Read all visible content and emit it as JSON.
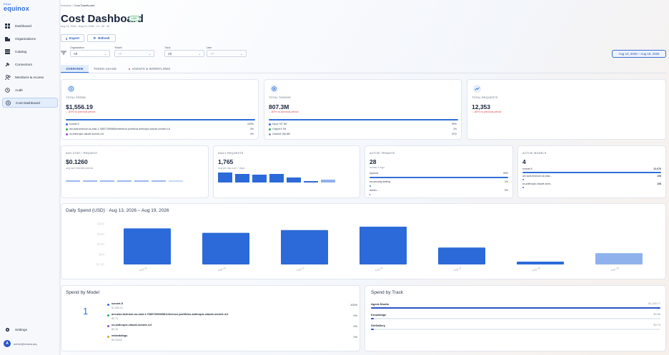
{
  "brand": {
    "line1": "Eltaz",
    "line2": "equinox"
  },
  "sidebar": {
    "items": [
      {
        "label": "Dashboard",
        "icon": "grid-icon"
      },
      {
        "label": "Organizations",
        "icon": "building-icon"
      },
      {
        "label": "Catalog",
        "icon": "catalog-icon"
      },
      {
        "label": "Connectors",
        "icon": "plug-icon"
      },
      {
        "label": "Members & Access",
        "icon": "users-icon"
      },
      {
        "label": "Audit",
        "icon": "history-icon"
      },
      {
        "label": "Cost Dashboard",
        "icon": "dollar-icon"
      }
    ],
    "settings": "Settings",
    "user": {
      "initial": "A",
      "email": "admin@retava.aiq"
    }
  },
  "breadcrumb": {
    "root": "Instance",
    "sep": "/",
    "current": "Cost Dashboard"
  },
  "page": {
    "title": "Cost Dashboard",
    "badge": "LIVE",
    "subtitle": "Aug 13, 2026 – Aug 19, 2026 · 14 · 49 · 44"
  },
  "actions": {
    "export": "Export",
    "refresh": "Refresh"
  },
  "filters": {
    "organization": {
      "label": "Organization",
      "value": "All"
    },
    "tenant": {
      "label": "Tenant",
      "value": "All"
    },
    "track": {
      "label": "Track",
      "value": "All"
    },
    "user": {
      "label": "User",
      "value": "All"
    }
  },
  "date_button": "Aug 13, 2026 – Aug 19, 2026",
  "tabs": [
    "OVERVIEW",
    "TOKEN USAGE",
    "AGENTS & WORKFLOWS"
  ],
  "kpi": {
    "spend": {
      "label": "TOTAL SPEND",
      "value": "$1,556.19",
      "delta": "↓ -53% vs previous period",
      "rows": [
        {
          "name": "sonnet-5",
          "pct": "100%",
          "color": "#2f6fd8"
        },
        {
          "name": "arn:aws:bedrock:us-east-1:768072969658:inference-profile/us.anthropic.claude-sonnet-4-6",
          "pct": "0%",
          "color": "#2fa66a"
        },
        {
          "name": "us.anthropic.claude-sonnet-4-6",
          "pct": "0%",
          "color": "#8a4fd8"
        }
      ]
    },
    "tokens": {
      "label": "TOTAL TOKENS",
      "value": "807.3M",
      "delta": "↓ -82% vs previous period",
      "rows": [
        {
          "name": "Input 797.3M",
          "pct": "99%",
          "color": "#2f6fd8"
        },
        {
          "name": "Output 5.7M",
          "pct": "1%",
          "color": "#2fa66a"
        },
        {
          "name": "Cached 166.8M",
          "pct": "21%",
          "color": "#8a93a3"
        }
      ]
    },
    "requests": {
      "label": "TOTAL REQUESTS",
      "value": "12,353",
      "delta": "↓ -80% vs previous period"
    }
  },
  "cards2": {
    "avg": {
      "label": "AVG COST / REQUEST",
      "value": "$0.1260",
      "sub": "avg over selected period"
    },
    "daily": {
      "label": "DAILY REQUESTS",
      "value": "1,765",
      "sub": "avg per day over 7 days"
    },
    "tenants": {
      "label": "ACTIVE TENANTS",
      "value": "28",
      "sub": "across 4 orgs",
      "rows": [
        {
          "name": "equinox",
          "pct": "99%"
        },
        {
          "name": "ics-security-testing",
          "pct": "1%"
        },
        {
          "name": "admin-...",
          "pct": "0%"
        }
      ]
    },
    "models": {
      "label": "ACTIVE MODELS",
      "value": "4",
      "rows": [
        {
          "name": "sonnet-5",
          "val": "12,075"
        },
        {
          "name": "arn:aws:bedrock:us-east-...",
          "val": "108"
        },
        {
          "name": "us.anthropic.claude-sonn...",
          "val": "108"
        }
      ]
    }
  },
  "daily_spend": {
    "title": "Daily Spend (USD) · Aug 13, 2026 – Aug 19, 2026",
    "chart_data": {
      "type": "bar",
      "categories": [
        "Aug 13",
        "Aug 14",
        "Aug 15",
        "Aug 16",
        "Aug 17",
        "Aug 18",
        "Aug 19"
      ],
      "values": [
        320,
        280,
        305,
        335,
        150,
        25,
        100
      ],
      "yticks": [
        "$300",
        "$250",
        "$160",
        "$84",
        "$0.00"
      ],
      "ylim": [
        0,
        360
      ],
      "colors": [
        "#2b6ad8",
        "#2b6ad8",
        "#2b6ad8",
        "#2b6ad8",
        "#2b6ad8",
        "#2b6ad8",
        "#8fb2ec"
      ]
    }
  },
  "spend_by_model": {
    "title": "Spend by Model",
    "count": "1",
    "rows": [
      {
        "name": "sonnet-5",
        "value": "$1,555.01",
        "pct": "100%",
        "color": "#2f6fd8"
      },
      {
        "name": "arn:aws:bedrock:us-east-1:768072969658:inference-profile/us.anthropic.claude-sonnet-4-6",
        "value": "$0.73",
        "pct": "0%",
        "color": "#2fa66a"
      },
      {
        "name": "us.anthropic.claude-sonnet-4-6",
        "value": "$0.16",
        "pct": "0%",
        "color": "#8a4fd8"
      },
      {
        "name": "embeddings",
        "value": "$0.00005",
        "pct": "0%",
        "color": "#e0a21b"
      }
    ]
  },
  "spend_by_track": {
    "title": "Spend by Track",
    "rows": [
      {
        "name": "Agent-Studio",
        "value": "$1,155.77",
        "share": 1.0
      },
      {
        "name": "Knowledge",
        "value": "$0.86",
        "share": 0.01
      },
      {
        "name": "SiriGallery",
        "value": "$0.73",
        "share": 0.01
      }
    ]
  }
}
